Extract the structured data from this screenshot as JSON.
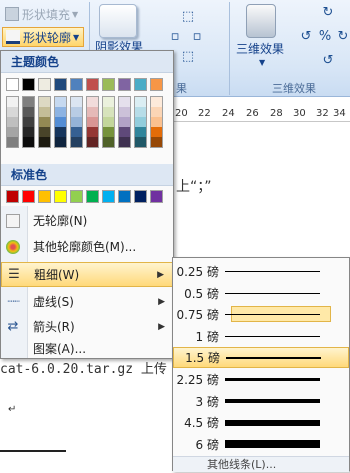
{
  "ribbon": {
    "shape_fill_label": "形状填充",
    "shape_outline_label": "形状轮廓",
    "shadow_effect_label": "阴影效果",
    "shadow_group_label": "果",
    "three_d_effect_label": "三维效果",
    "three_d_group_label": "三维效果"
  },
  "ruler": {
    "ticks": [
      "20",
      "22",
      "24",
      "26",
      "28",
      "30",
      "32",
      "34"
    ]
  },
  "document": {
    "line1": "上“；”",
    "line2": "cat-6.0.20.tar.gz 上传",
    "para_mark": "↵"
  },
  "menu": {
    "theme_colors_title": "主题颜色",
    "standard_colors_title": "标准色",
    "theme_base": [
      "#ffffff",
      "#000000",
      "#eeece1",
      "#1f497d",
      "#4f81bd",
      "#c0504d",
      "#9bbb59",
      "#8064a2",
      "#4bacc6",
      "#f79646"
    ],
    "theme_shades": [
      [
        "#f2f2f2",
        "#d8d8d8",
        "#bfbfbf",
        "#a5a5a5",
        "#7f7f7f"
      ],
      [
        "#7f7f7f",
        "#595959",
        "#3f3f3f",
        "#262626",
        "#0c0c0c"
      ],
      [
        "#ddd9c3",
        "#c4bd97",
        "#938953",
        "#494429",
        "#1d1b10"
      ],
      [
        "#c6d9f0",
        "#8db3e2",
        "#548dd4",
        "#17365d",
        "#0f243e"
      ],
      [
        "#dbe5f1",
        "#b8cce4",
        "#95b3d7",
        "#366092",
        "#244061"
      ],
      [
        "#f2dcdb",
        "#e5b9b7",
        "#d99694",
        "#953734",
        "#632423"
      ],
      [
        "#ebf1dd",
        "#d7e3bc",
        "#c3d69b",
        "#76923c",
        "#4f6128"
      ],
      [
        "#e5e0ec",
        "#ccc1d9",
        "#b2a2c7",
        "#5f497a",
        "#3f3151"
      ],
      [
        "#dbeef3",
        "#b7dde8",
        "#92cddc",
        "#31859b",
        "#205867"
      ],
      [
        "#fdeada",
        "#fbd5b5",
        "#fac08f",
        "#e36c09",
        "#974806"
      ]
    ],
    "standard": [
      "#c00000",
      "#ff0000",
      "#ffc000",
      "#ffff00",
      "#92d050",
      "#00b050",
      "#00b0f0",
      "#0070c0",
      "#002060",
      "#7030a0"
    ],
    "no_outline": "无轮廓(N)",
    "more_colors": "其他轮廓颜色(M)...",
    "weight": "粗细(W)",
    "dashes": "虚线(S)",
    "arrows": "箭头(R)",
    "pattern": "图案(A)..."
  },
  "weights": {
    "items": [
      {
        "label": "0.25 磅",
        "pt": 0.25
      },
      {
        "label": "0.5 磅",
        "pt": 0.5
      },
      {
        "label": "0.75 磅",
        "pt": 0.75
      },
      {
        "label": "1 磅",
        "pt": 1
      },
      {
        "label": "1.5 磅",
        "pt": 1.5
      },
      {
        "label": "2.25 磅",
        "pt": 2.25
      },
      {
        "label": "3 磅",
        "pt": 3
      },
      {
        "label": "4.5 磅",
        "pt": 4.5
      },
      {
        "label": "6 磅",
        "pt": 6
      }
    ],
    "highlighted": "1.5 磅",
    "selected": "0.75 磅",
    "more_lines": "其他线条(L)..."
  }
}
